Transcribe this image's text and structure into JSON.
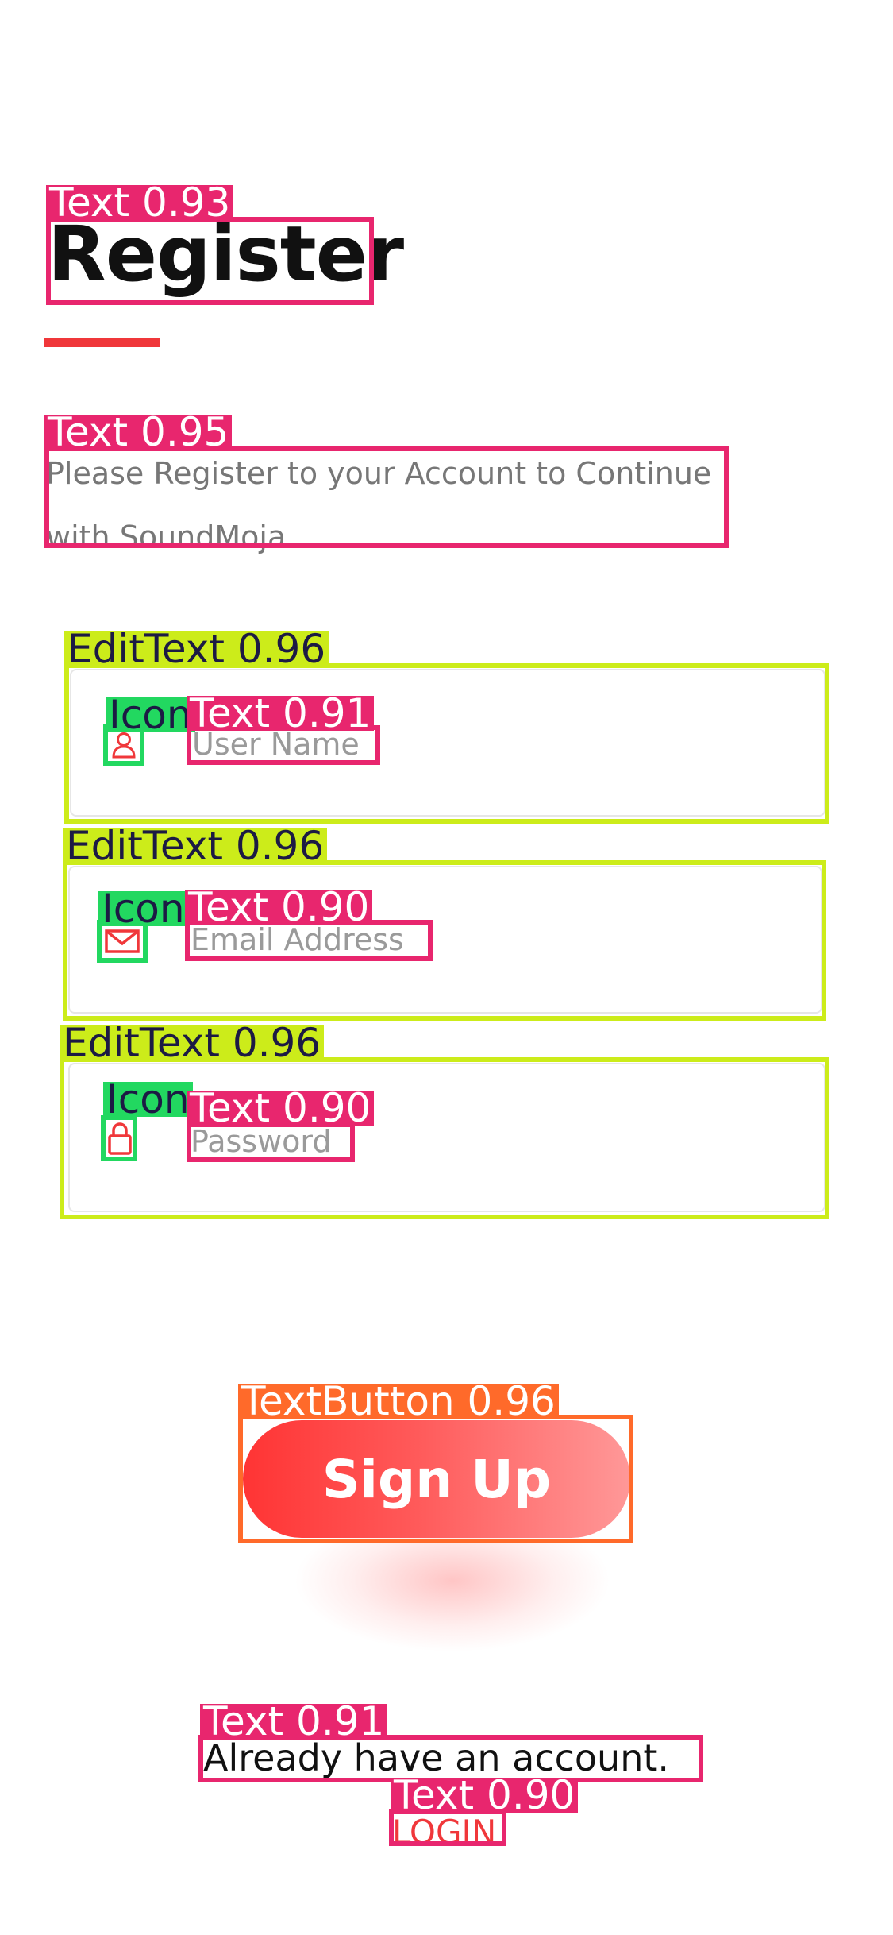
{
  "screen": {
    "title": "Register",
    "subtitle_line1": "Please Register to your Account to Continue",
    "subtitle_line2": "with SoundMoja."
  },
  "form": {
    "username_placeholder": "User Name",
    "username_icon": "user-icon",
    "email_placeholder": "Email Address",
    "email_icon": "mail-icon",
    "password_placeholder": "Password",
    "password_icon": "lock-icon"
  },
  "actions": {
    "signup_label": "Sign Up",
    "already_text": "Already have an account.",
    "login_label": "LOGIN"
  },
  "detections": {
    "title": "Text  0.93",
    "subtitle": "Text  0.95",
    "edit_username": "EditText  0.96",
    "icon_username": "Icon",
    "text_username": "Text  0.91",
    "edit_email": "EditText  0.96",
    "icon_email": "Icon",
    "text_email": "Text  0.90",
    "edit_password": "EditText  0.96",
    "icon_password": "Icon",
    "text_password": "Text  0.90",
    "signup_button": "TextButton  0.96",
    "already": "Text  0.91",
    "login": "Text  0.90"
  },
  "colors": {
    "accent": "#f0373a",
    "text_box": "#e8266e",
    "edittext_box": "#ccec1a",
    "icon_box": "#22d860",
    "button_box": "#ff6a2a"
  }
}
